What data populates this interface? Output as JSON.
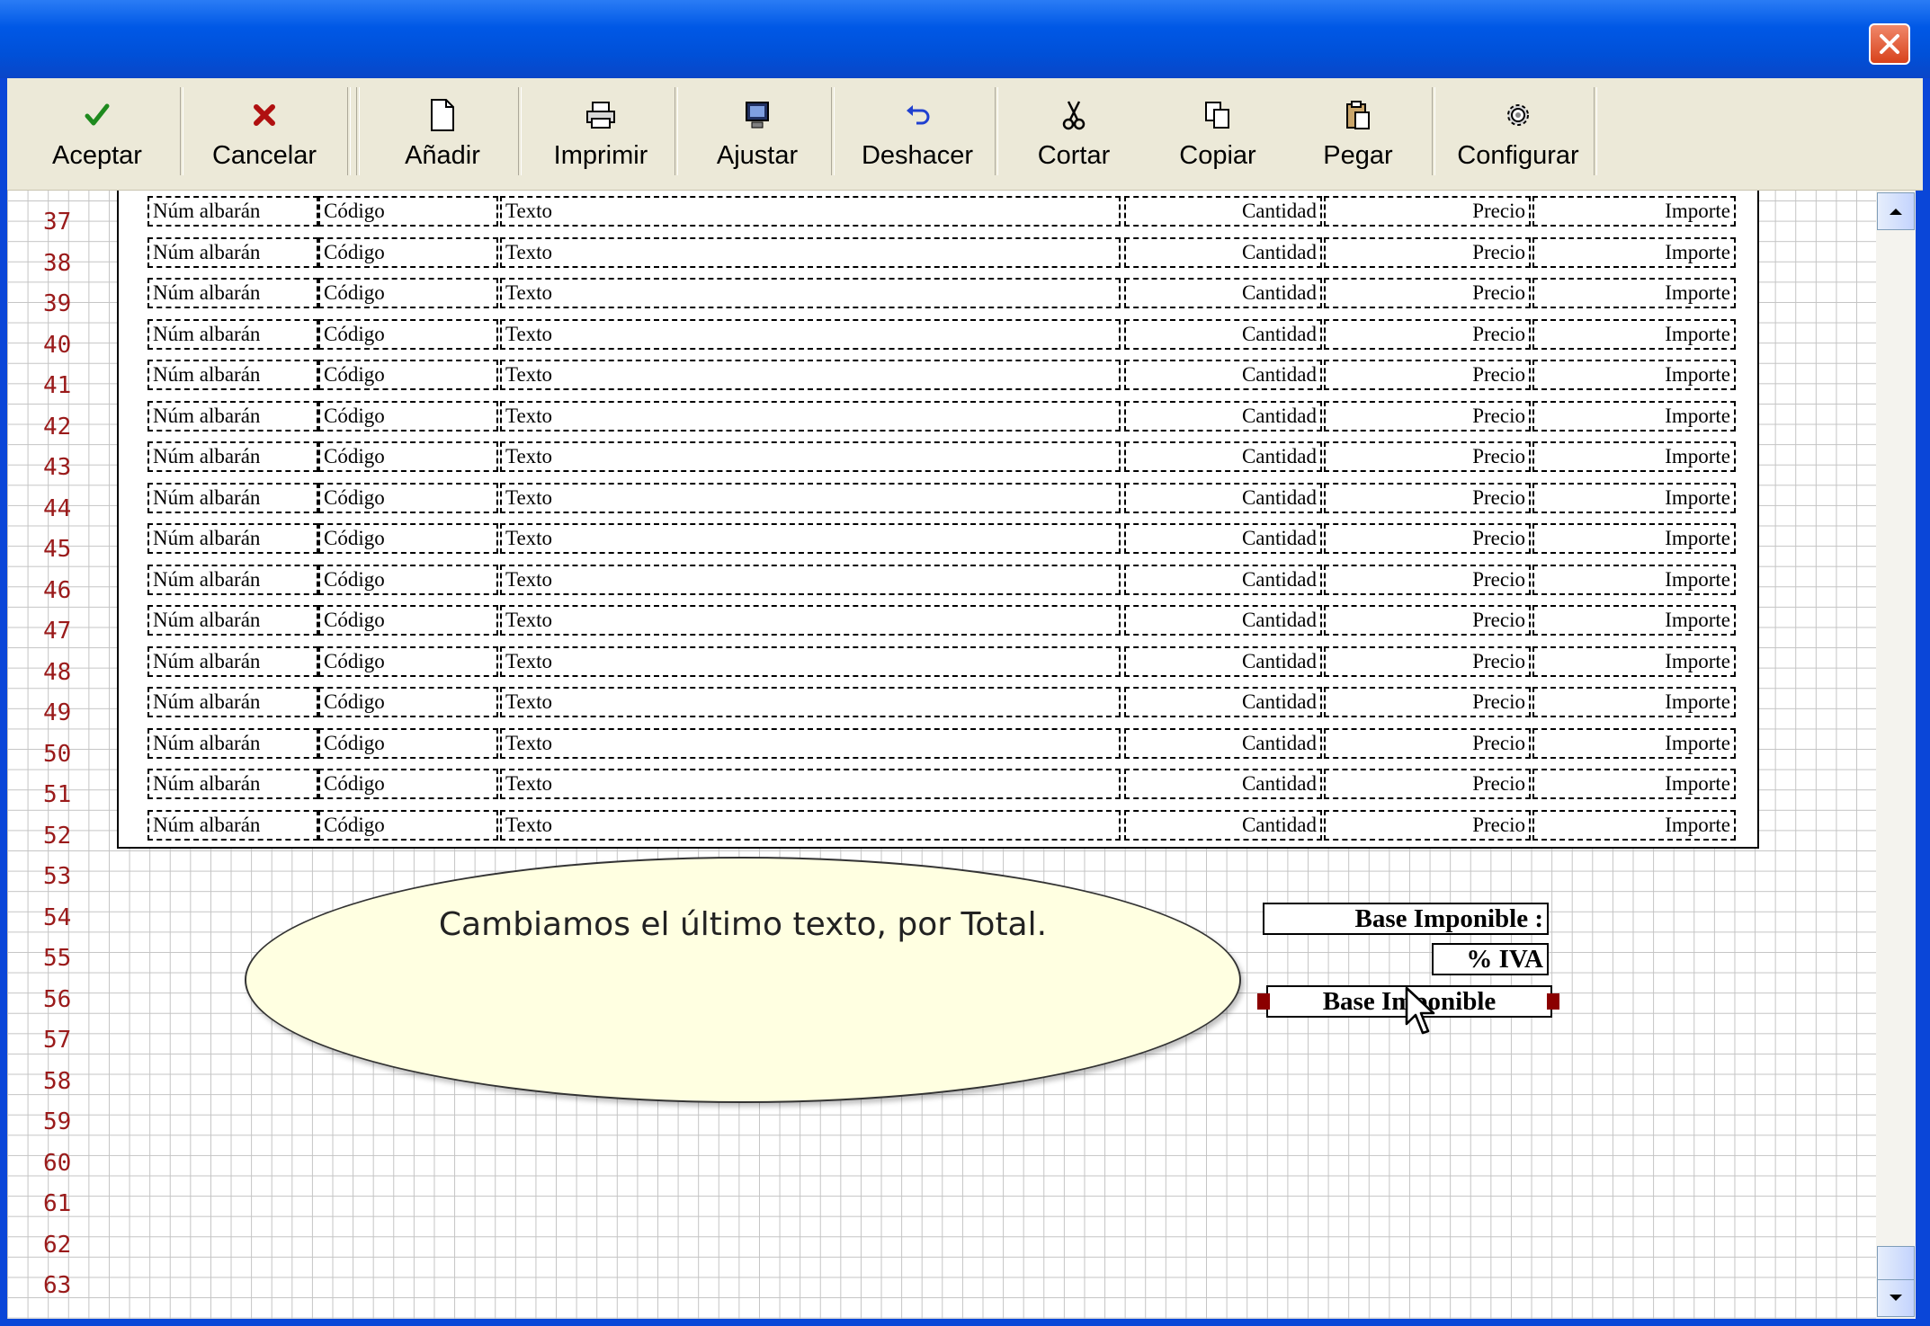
{
  "window": {
    "title": ""
  },
  "toolbar": {
    "buttons": [
      {
        "label": "Aceptar",
        "icon": "check-icon"
      },
      {
        "label": "Cancelar",
        "icon": "x-icon"
      },
      {
        "label": "Añadir",
        "icon": "new-page-icon"
      },
      {
        "label": "Imprimir",
        "icon": "printer-icon"
      },
      {
        "label": "Ajustar",
        "icon": "monitor-icon"
      },
      {
        "label": "Deshacer",
        "icon": "undo-icon"
      },
      {
        "label": "Cortar",
        "icon": "scissors-icon"
      },
      {
        "label": "Copiar",
        "icon": "copy-icon"
      },
      {
        "label": "Pegar",
        "icon": "paste-icon"
      },
      {
        "label": "Configurar",
        "icon": "gear-icon"
      }
    ]
  },
  "ruler_rows": [
    "37",
    "38",
    "39",
    "40",
    "41",
    "42",
    "43",
    "44",
    "45",
    "46",
    "47",
    "48",
    "49",
    "50",
    "51",
    "52",
    "53",
    "54",
    "55",
    "56",
    "57",
    "58",
    "59",
    "60",
    "61",
    "62",
    "63"
  ],
  "detail_row": {
    "num_albaran": "Núm albarán",
    "codigo": "Código",
    "texto": "Texto",
    "cantidad": "Cantidad",
    "precio": "Precio",
    "importe": "Importe"
  },
  "detail_row_count": 16,
  "totals": {
    "base_imponible": "Base Imponible :",
    "iva": "% IVA",
    "selected_field": "Base Imponible"
  },
  "callout": {
    "text": "Cambiamos el último texto, por Total."
  },
  "colors": {
    "title_bar": "#0058e6",
    "toolbar_bg": "#ece9d8",
    "ruler_numbers": "#9a1a1a",
    "callout_bg": "#ffffe1",
    "selection_handles": "#8b0000"
  }
}
